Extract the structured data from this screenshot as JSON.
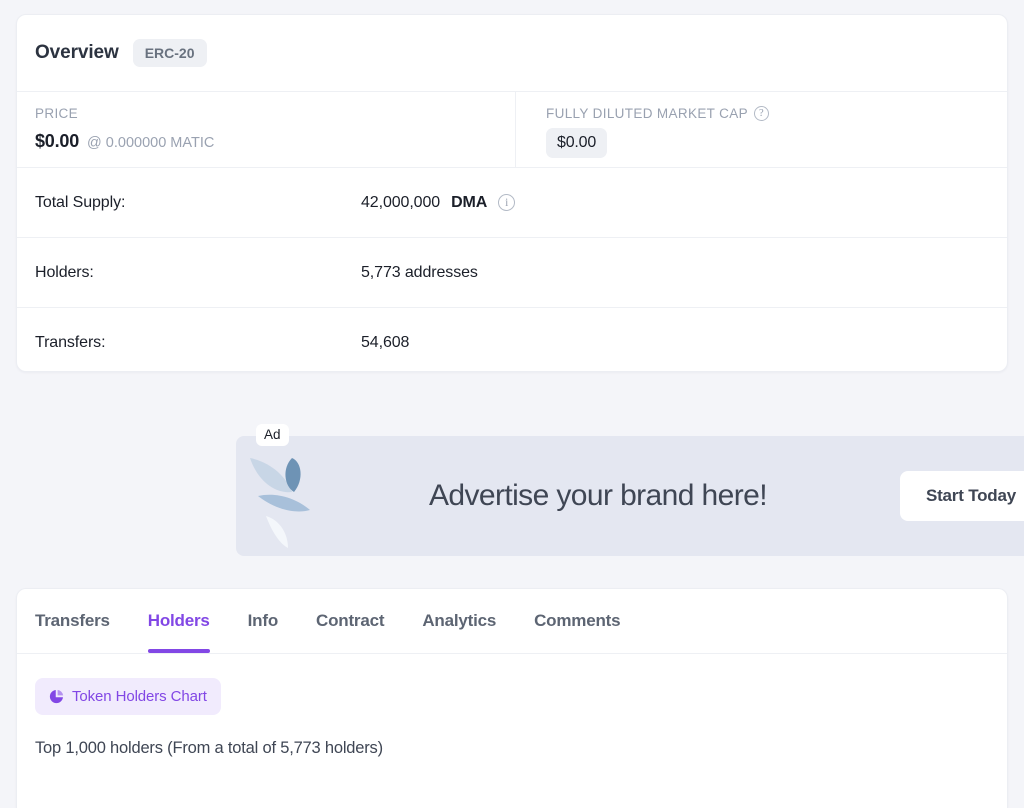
{
  "overview": {
    "title": "Overview",
    "token_standard_badge": "ERC-20",
    "price": {
      "label": "PRICE",
      "value": "$0.00",
      "sub_value": "@ 0.000000 MATIC"
    },
    "fully_diluted_market_cap": {
      "label": "FULLY DILUTED MARKET CAP",
      "help_icon": "question-circle-icon",
      "value": "$0.00"
    },
    "rows": [
      {
        "key": "Total Supply:",
        "value": "42,000,000",
        "symbol": "DMA",
        "info_icon": "info-circle-icon"
      },
      {
        "key": "Holders:",
        "value": "5,773 addresses",
        "symbol": "",
        "info_icon": ""
      },
      {
        "key": "Transfers:",
        "value": "54,608",
        "symbol": "",
        "info_icon": ""
      }
    ]
  },
  "ad": {
    "label": "Ad",
    "logo_icon": "leaf-logo-icon",
    "headline": "Advertise your brand here!",
    "cta_label": "Start Today",
    "background_color": "#e4e7f1"
  },
  "tabs": {
    "items": [
      {
        "label": "Transfers",
        "active": false
      },
      {
        "label": "Holders",
        "active": true
      },
      {
        "label": "Info",
        "active": false
      },
      {
        "label": "Contract",
        "active": false
      },
      {
        "label": "Analytics",
        "active": false
      },
      {
        "label": "Comments",
        "active": false
      }
    ],
    "active_color": "#8247e5"
  },
  "holders_panel": {
    "chart_button_label": "Token Holders Chart",
    "chart_button_icon": "pie-chart-icon",
    "summary": "Top 1,000 holders (From a total of 5,773 holders)"
  }
}
